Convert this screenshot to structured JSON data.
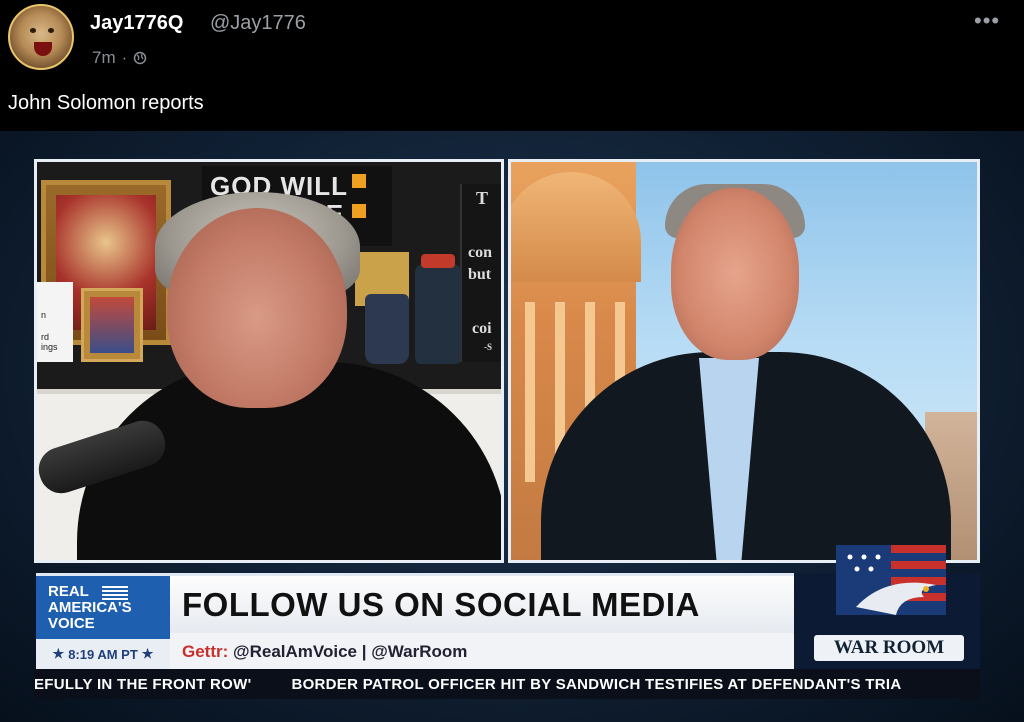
{
  "post": {
    "display_name": "Jay1776Q",
    "handle": "@Jay1776",
    "time": "7m",
    "separator": "·",
    "text": "John Solomon reports",
    "more_icon": "ellipsis-icon"
  },
  "video": {
    "sign_text_line1": "GOD WILL",
    "sign_text_line2": "BE",
    "card_lines": [
      "T",
      "con",
      "but",
      "coi",
      "-S"
    ],
    "paper_lines": [
      "n",
      "rd",
      "ings"
    ],
    "lower_third": {
      "logo_lines": [
        "REAL",
        "AMERICA'S",
        "VOICE"
      ],
      "time": "8:19 AM PT",
      "headline": "FOLLOW US ON SOCIAL MEDIA",
      "sub_prefix": "Gettr:",
      "sub_text": "@RealAmVoice | @WarRoom",
      "warroom_label": "WAR ROOM"
    },
    "ticker": [
      "EFULLY IN THE FRONT ROW'",
      "BORDER PATROL OFFICER HIT BY SANDWICH TESTIFIES AT DEFENDANT'S TRIA"
    ]
  },
  "colors": {
    "accent_blue": "#1f5fb0",
    "warroom_navy": "#0c1a34",
    "flag_red": "#c8312b"
  }
}
